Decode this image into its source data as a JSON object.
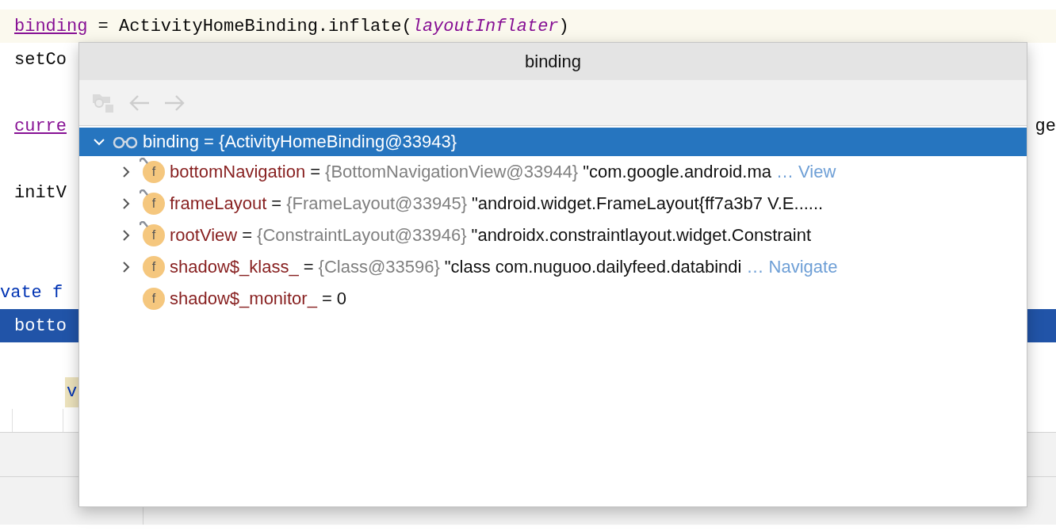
{
  "editor": {
    "lines": [
      {
        "highlighted": true,
        "selected": false,
        "segments": [
          {
            "kind": "field",
            "text": "binding"
          },
          {
            "kind": "plain",
            "text": " = ActivityHomeBinding.inflate("
          },
          {
            "kind": "param",
            "text": "layoutInflater"
          },
          {
            "kind": "plain",
            "text": ")"
          }
        ]
      },
      {
        "highlighted": false,
        "selected": false,
        "segments": [
          {
            "kind": "plain",
            "text": "setCo"
          }
        ]
      },
      {
        "highlighted": false,
        "selected": false,
        "segments": [
          {
            "kind": "field",
            "text": "curre"
          }
        ],
        "tail": "ge"
      },
      {
        "highlighted": false,
        "selected": false,
        "segments": [
          {
            "kind": "plain",
            "text": "initV"
          }
        ]
      },
      {
        "highlighted": false,
        "selected": false,
        "segments": [
          {
            "kind": "keyword",
            "text": "vate f"
          }
        ]
      },
      {
        "highlighted": false,
        "selected": true,
        "segments": [
          {
            "kind": "plain",
            "text": "botto"
          }
        ]
      },
      {
        "highlighted": false,
        "selected": false,
        "segments": [
          {
            "kind": "usage",
            "text": "v"
          }
        ]
      }
    ]
  },
  "popup": {
    "title": "binding",
    "toolbar": [
      {
        "kind": "watch",
        "disabled": true
      },
      {
        "kind": "back",
        "disabled": true
      },
      {
        "kind": "forward",
        "disabled": true
      }
    ],
    "tree": {
      "name": "binding",
      "sign": "=",
      "value": "{ActivityHomeBinding@33943}",
      "selected": true,
      "expanded": true,
      "children": [
        {
          "badge": "f",
          "name": "bottomNavigation",
          "sign": "=",
          "value": "{BottomNavigationView@33944}",
          "string": "\"com.google.android.ma",
          "link": "… View",
          "expandable": true,
          "final": true,
          "selected": false
        },
        {
          "badge": "f",
          "name": "frameLayout",
          "sign": "=",
          "value": "{FrameLayout@33945}",
          "string": "\"android.widget.FrameLayout{ff7a3b7 V.E......",
          "expandable": true,
          "final": true,
          "selected": false
        },
        {
          "badge": "f",
          "name": "rootView",
          "sign": "=",
          "value": "{ConstraintLayout@33946}",
          "string": "\"androidx.constraintlayout.widget.Constraint",
          "expandable": true,
          "final": true,
          "selected": false
        },
        {
          "badge": "f",
          "name": "shadow$_klass_",
          "sign": "=",
          "value": "{Class@33596}",
          "string": "\"class com.nuguoo.dailyfeed.databindi",
          "link": "… Navigate",
          "expandable": true,
          "final": false,
          "selected": false
        },
        {
          "badge": "f",
          "name": "shadow$_monitor_",
          "sign": "=",
          "primitive": "0",
          "expandable": false,
          "final": false,
          "selected": false
        }
      ]
    }
  }
}
